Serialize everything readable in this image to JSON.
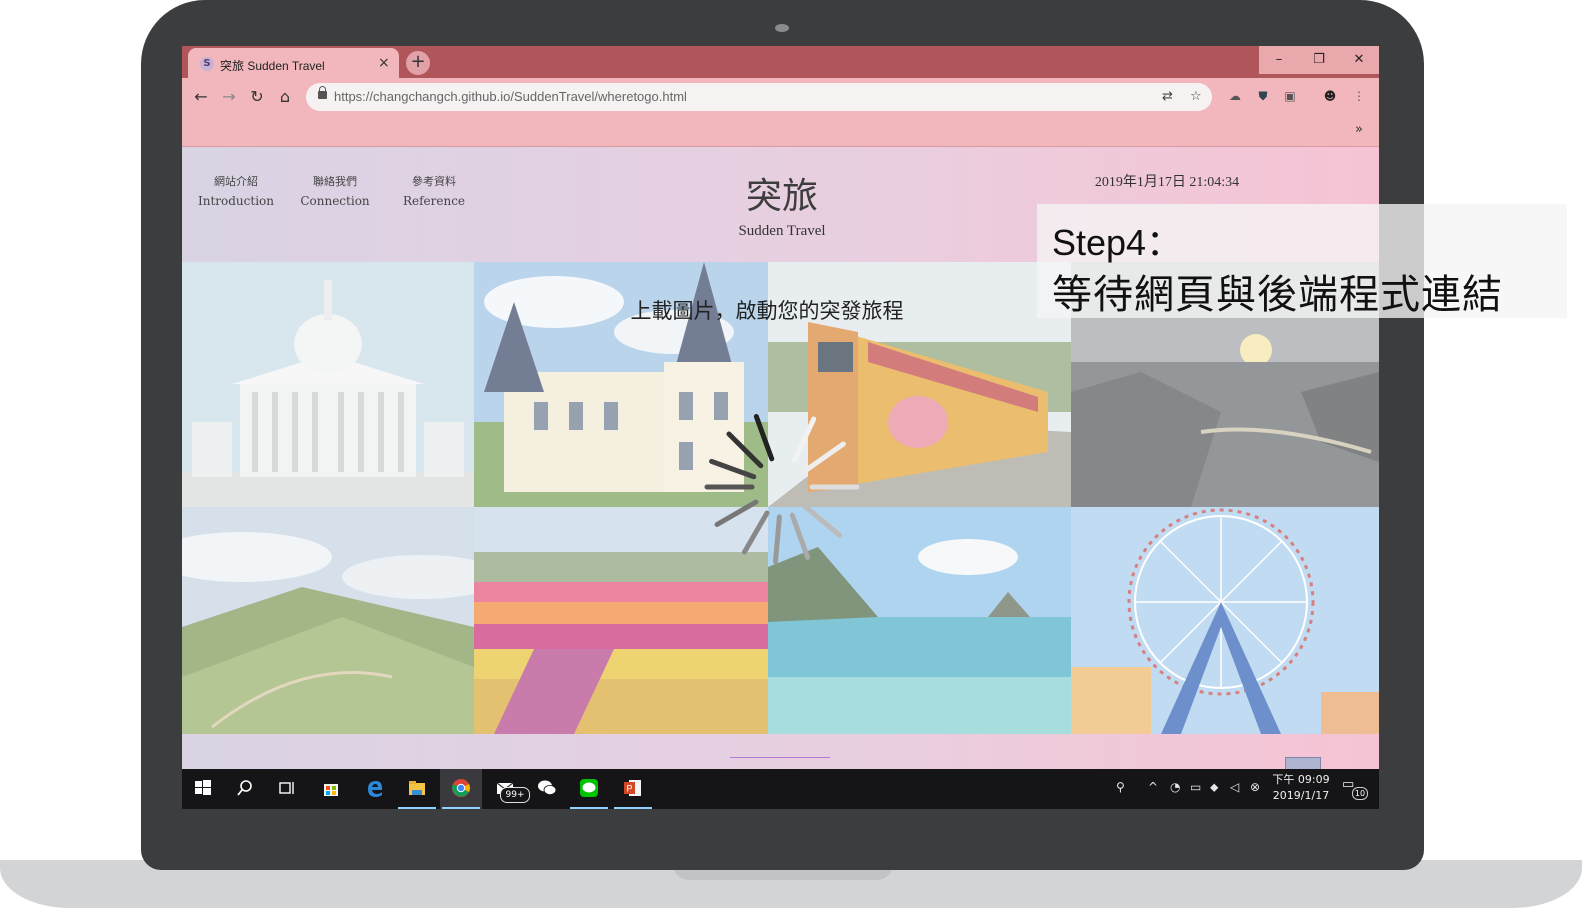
{
  "browser": {
    "tab_title": "突旅 Sudden Travel",
    "tab_close": "×",
    "new_tab": "+",
    "window_controls": {
      "minimize": "–",
      "restore": "❐",
      "close": "✕"
    },
    "url": "https://changchangch.github.io/SuddenTravel/wheretogo.html",
    "bookmarks_more": "»"
  },
  "site": {
    "nav": [
      {
        "zh": "網站介紹",
        "en": "Introduction"
      },
      {
        "zh": "聯絡我們",
        "en": "Connection"
      },
      {
        "zh": "參考資料",
        "en": "Reference"
      }
    ],
    "logo_zh": "突旅",
    "logo_en": "Sudden Travel",
    "datetime": "2019年1月17日 21:04:34",
    "upload_prompt": "上載圖片，啟動您的突發旅程"
  },
  "overlay": {
    "step": "Step4：",
    "description": "等待網頁與後端程式連結"
  },
  "taskbar": {
    "time": "下午 09:09",
    "date": "2019/1/17",
    "mail_badge": "99+",
    "notification_count": "10"
  },
  "colors": {
    "tabstrip": "#b0565a",
    "toolbar": "#f2b7bc",
    "page_gradient_left": "#d9d3e4",
    "page_gradient_right": "#f6c3d4",
    "taskbar": "#151517",
    "laptop_frame": "#3c3d3f"
  }
}
